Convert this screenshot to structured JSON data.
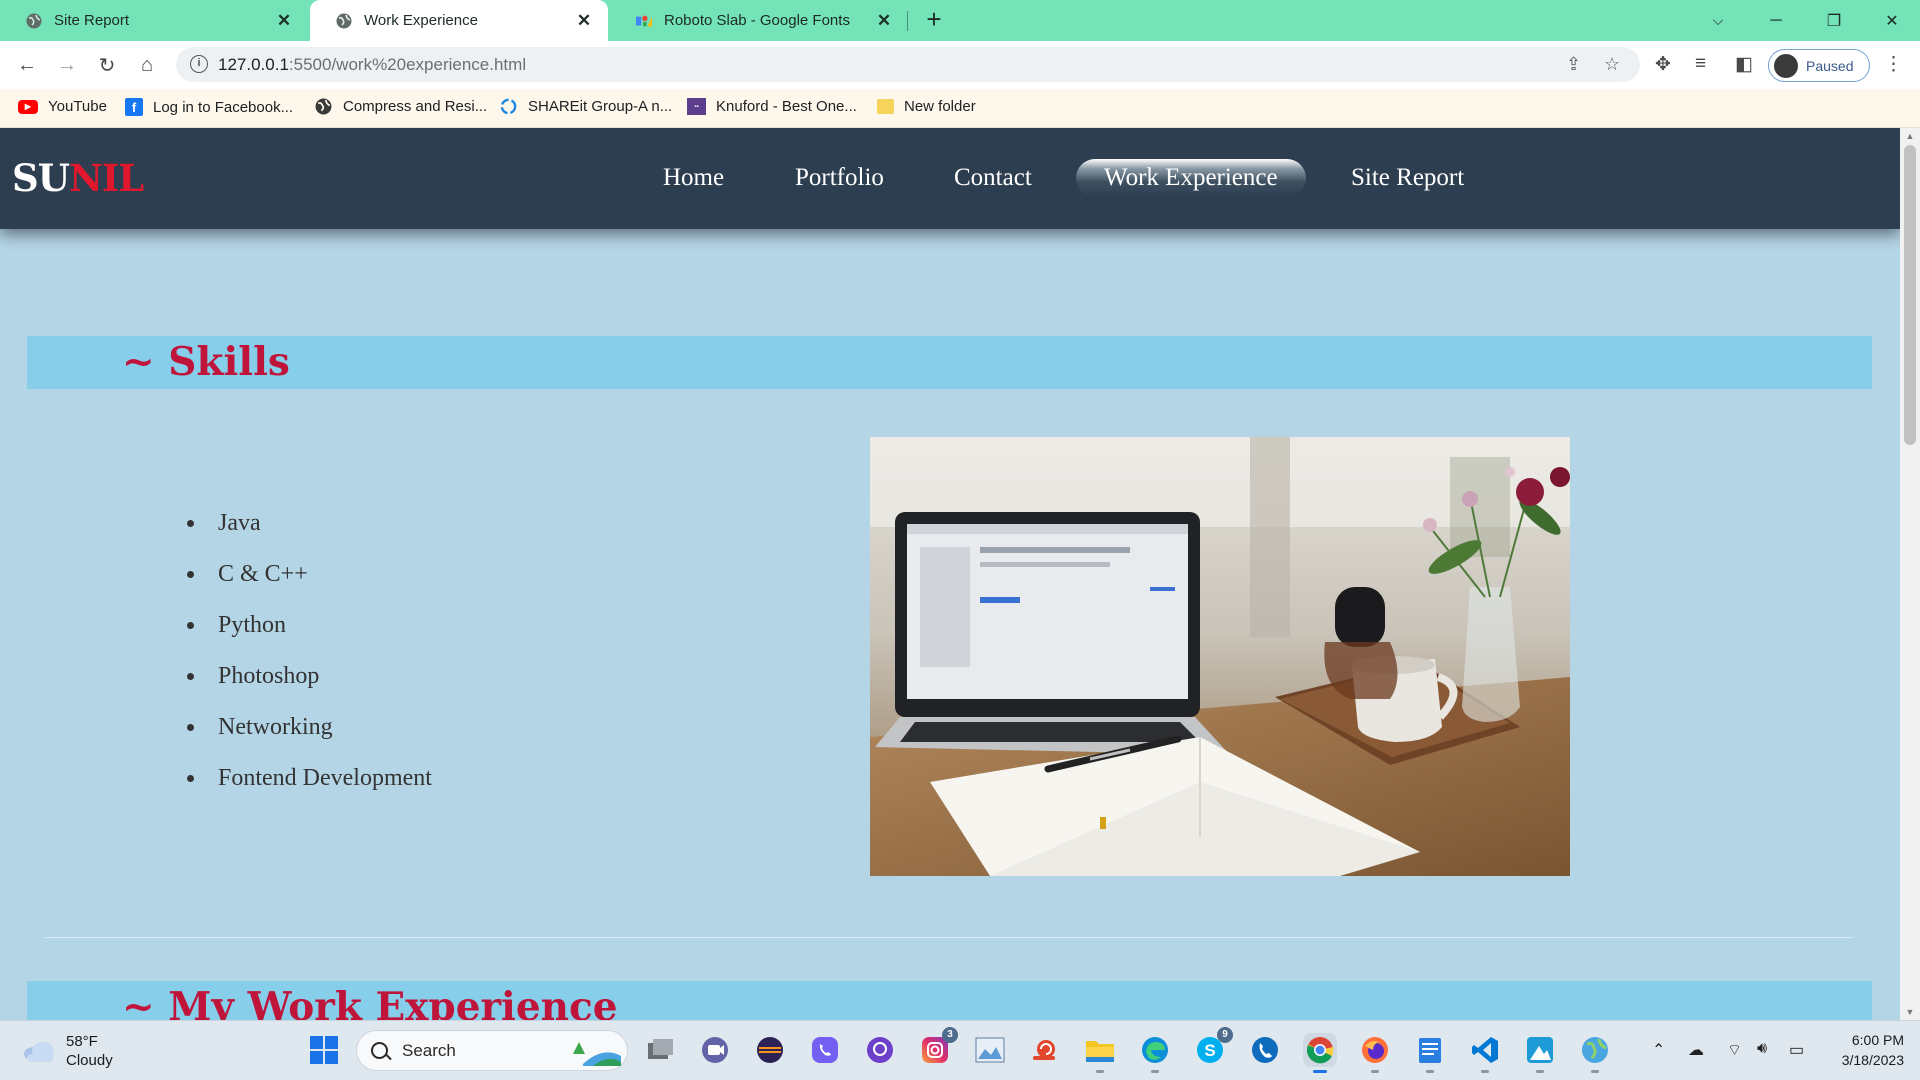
{
  "browser": {
    "tabs": [
      {
        "title": "Site Report",
        "active": false
      },
      {
        "title": "Work Experience",
        "active": true
      },
      {
        "title": "Roboto Slab - Google Fonts",
        "active": false
      }
    ],
    "address": {
      "host": "127.0.0.1",
      "rest": ":5500/work%20experience.html"
    },
    "profile_label": "Paused",
    "bookmarks": [
      {
        "label": "YouTube",
        "icon": "youtube-icon"
      },
      {
        "label": "Log in to Facebook...",
        "icon": "facebook-icon"
      },
      {
        "label": "Compress and Resi...",
        "icon": "globe-icon"
      },
      {
        "label": "SHAREit Group-A n...",
        "icon": "shareit-icon"
      },
      {
        "label": "Knuford - Best One...",
        "icon": "knuford-icon"
      },
      {
        "label": "New folder",
        "icon": "folder-icon"
      }
    ]
  },
  "site": {
    "logo": {
      "part1": "SU",
      "part2": "NIL"
    },
    "nav": [
      "Home",
      "Portfolio",
      "Contact",
      "Work Experience",
      "Site Report"
    ],
    "active_nav": "Work Experience",
    "skills_heading": "~ Skills",
    "skills": [
      "Java",
      "C & C++",
      "Python",
      "Photoshop",
      "Networking",
      "Fontend Development"
    ],
    "work_heading": "~ My Work Experience",
    "colors": {
      "nav_bg": "#2c3e50",
      "page_bg": "#b4d5e6",
      "band_bg": "#87ceeb",
      "heading": "#c0153a",
      "logo_accent": "#e0182d"
    }
  },
  "taskbar": {
    "weather": {
      "temp": "58°F",
      "condition": "Cloudy"
    },
    "search_label": "Search",
    "time": "6:00 PM",
    "date": "3/18/2023",
    "badges": {
      "instagram": "3",
      "skype": "9"
    }
  }
}
